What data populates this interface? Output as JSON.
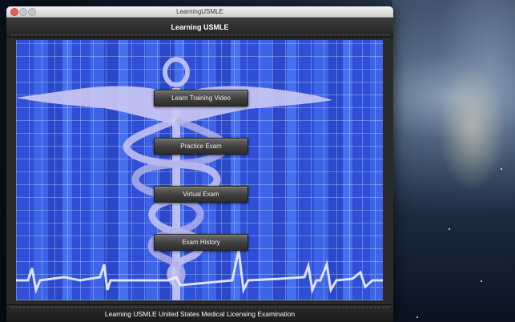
{
  "window": {
    "title": "LearningUSMLE"
  },
  "header": {
    "title": "Learning USMLE"
  },
  "menu": {
    "buttons": [
      {
        "label": "Learn Training Video"
      },
      {
        "label": "Practice Exam"
      },
      {
        "label": "Virtual Exam"
      },
      {
        "label": "Exam History"
      }
    ]
  },
  "footer": {
    "text": "Learning USMLE United States Medical Licensing Examination"
  },
  "colors": {
    "panel_blue": "#3357db",
    "caduceus": "#c9c6f2",
    "button_dark": "#3e3e3e",
    "close_button": "#ec5b56"
  },
  "icons": {
    "hero": "caduceus-icon",
    "pulse": "heartbeat-line"
  }
}
